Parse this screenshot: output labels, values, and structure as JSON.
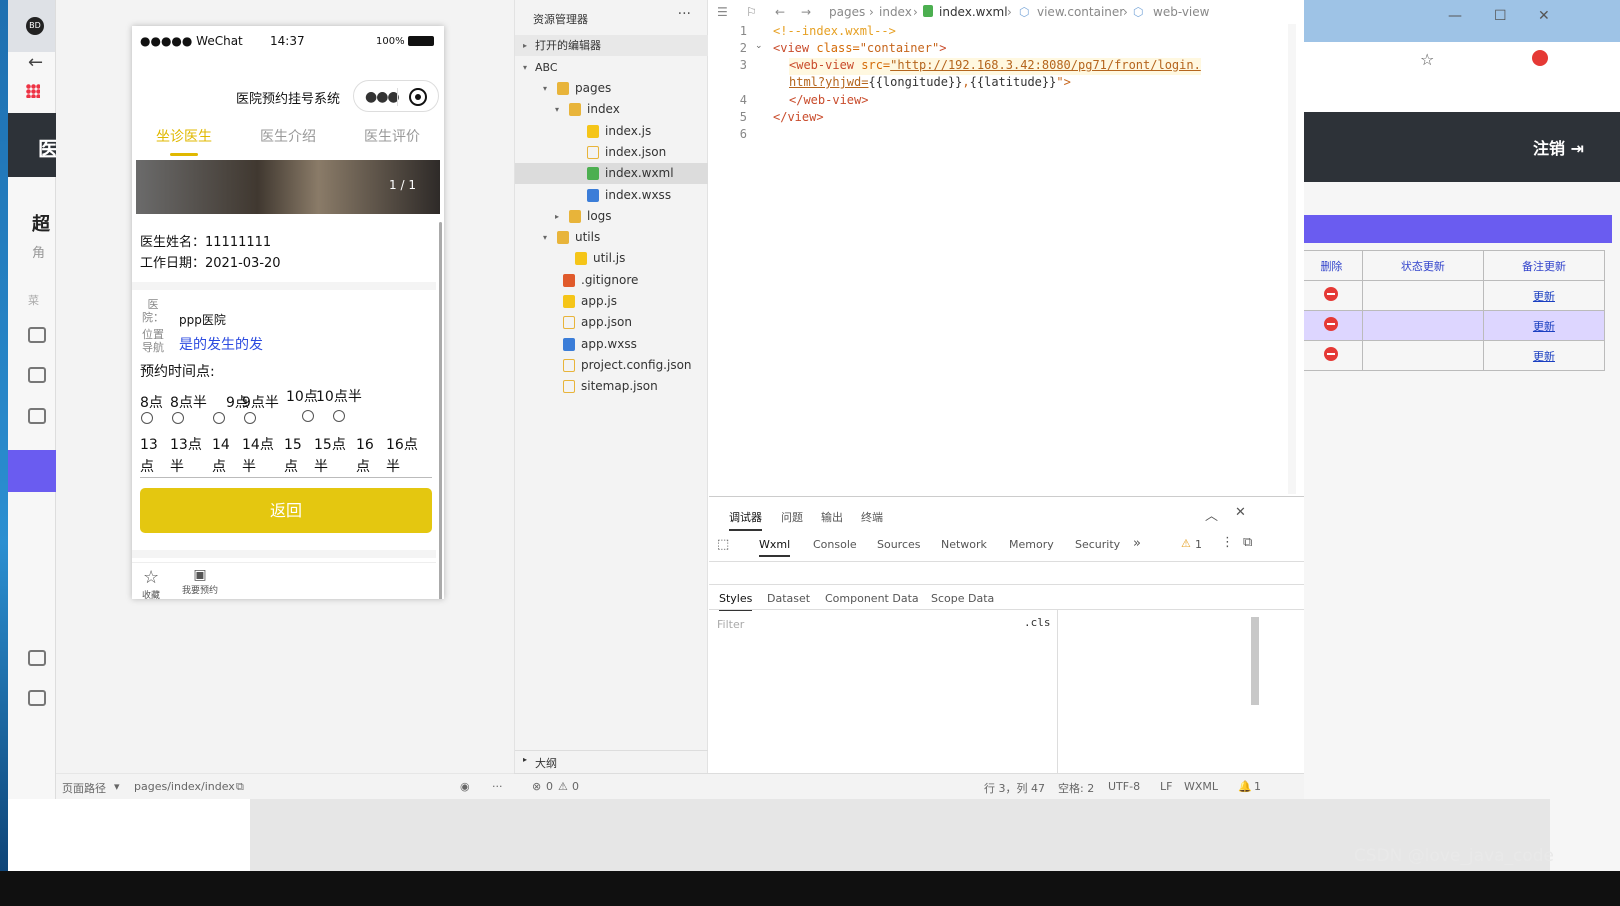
{
  "simulator": {
    "status_carrier": "●●●●● WeChat",
    "status_time": "14:37",
    "status_battery": "100%",
    "nav_title": "医院预约挂号系统",
    "tabs": [
      "坐诊医生",
      "医生介绍",
      "医生评价"
    ],
    "active_tab": 0,
    "banner_counter": "1 / 1",
    "doctor_name": "医生姓名：11111111",
    "work_date": "工作日期：2021-03-20",
    "hospital_label": "医院：",
    "hospital_value": "ppp医院",
    "location_label": "位置导航",
    "location_value": "是的发生的发",
    "time_label": "预约时间点:",
    "slots_row1": [
      "8点",
      "8点半",
      "9点",
      "9点半",
      "10点",
      "10点半"
    ],
    "slots_row2": [
      "13点",
      "13点半",
      "14点",
      "14点半",
      "15点",
      "15点半",
      "16点",
      "16点半"
    ],
    "back_button": "返回",
    "bottom_items": [
      "收藏",
      "我要预约"
    ],
    "footer_path_label": "页面路径",
    "footer_path": "pages/index/index"
  },
  "explorer": {
    "title": "资源管理器",
    "open_editors": "打开的编辑器",
    "project": "ABC",
    "tree": [
      {
        "label": "pages",
        "depth": 1,
        "kind": "folder"
      },
      {
        "label": "index",
        "depth": 2,
        "kind": "folder"
      },
      {
        "label": "index.js",
        "depth": 3,
        "kind": "js"
      },
      {
        "label": "index.json",
        "depth": 3,
        "kind": "json"
      },
      {
        "label": "index.wxml",
        "depth": 3,
        "kind": "wxml",
        "selected": true
      },
      {
        "label": "index.wxss",
        "depth": 3,
        "kind": "wxss"
      },
      {
        "label": "logs",
        "depth": 2,
        "kind": "folder"
      },
      {
        "label": "utils",
        "depth": 1,
        "kind": "folder"
      },
      {
        "label": "util.js",
        "depth": 2,
        "kind": "js"
      },
      {
        "label": ".gitignore",
        "depth": 1,
        "kind": "git"
      },
      {
        "label": "app.js",
        "depth": 1,
        "kind": "js"
      },
      {
        "label": "app.json",
        "depth": 1,
        "kind": "json"
      },
      {
        "label": "app.wxss",
        "depth": 1,
        "kind": "wxss"
      },
      {
        "label": "project.config.json",
        "depth": 1,
        "kind": "json"
      },
      {
        "label": "sitemap.json",
        "depth": 1,
        "kind": "json"
      }
    ],
    "outline": "大纲"
  },
  "editor": {
    "breadcrumb": [
      "pages",
      "index",
      "index.wxml",
      "view.container",
      "web-view"
    ],
    "lines": {
      "l1": "<!--index.wxml-->",
      "l2_tag": "<view",
      "l2_attr": " class=",
      "l2_str": "\"container\"",
      "l2_end": ">",
      "l3_tag": "<web-view",
      "l3_attr": " src=",
      "l3_url1": "\"http://192.168.3.42:8080/pg71/front/login.",
      "l3_url2": "html?yhjwd=",
      "l3_v1": "{{longitude}}",
      "l3_comma": ",",
      "l3_v2": "{{latitude}}",
      "l3_end": "\">",
      "l4": "</web-view>",
      "l5": "</view>"
    },
    "line_numbers": [
      "1",
      "2",
      "3",
      "4",
      "5",
      "6"
    ]
  },
  "devtools": {
    "top_tabs": [
      "调试器",
      "问题",
      "输出",
      "终端"
    ],
    "panel_tabs": [
      "Wxml",
      "Console",
      "Sources",
      "Network",
      "Memory",
      "Security"
    ],
    "warning_count": "1",
    "sub_tabs": [
      "Styles",
      "Dataset",
      "Component Data",
      "Scope Data"
    ],
    "filter_placeholder": "Filter",
    "cls_label": ".cls"
  },
  "status_bar": {
    "errors": "0",
    "warnings": "0",
    "position": "行 3，列 47",
    "spaces": "空格: 2",
    "encoding": "UTF-8",
    "eol": "LF",
    "language": "WXML",
    "notifications": "1"
  },
  "background_window": {
    "logout_label": "注销",
    "table_headers": [
      "删除",
      "状态更新",
      "备注更新"
    ],
    "update_link": "更新"
  },
  "watermark": "CSDN @love_java_code"
}
